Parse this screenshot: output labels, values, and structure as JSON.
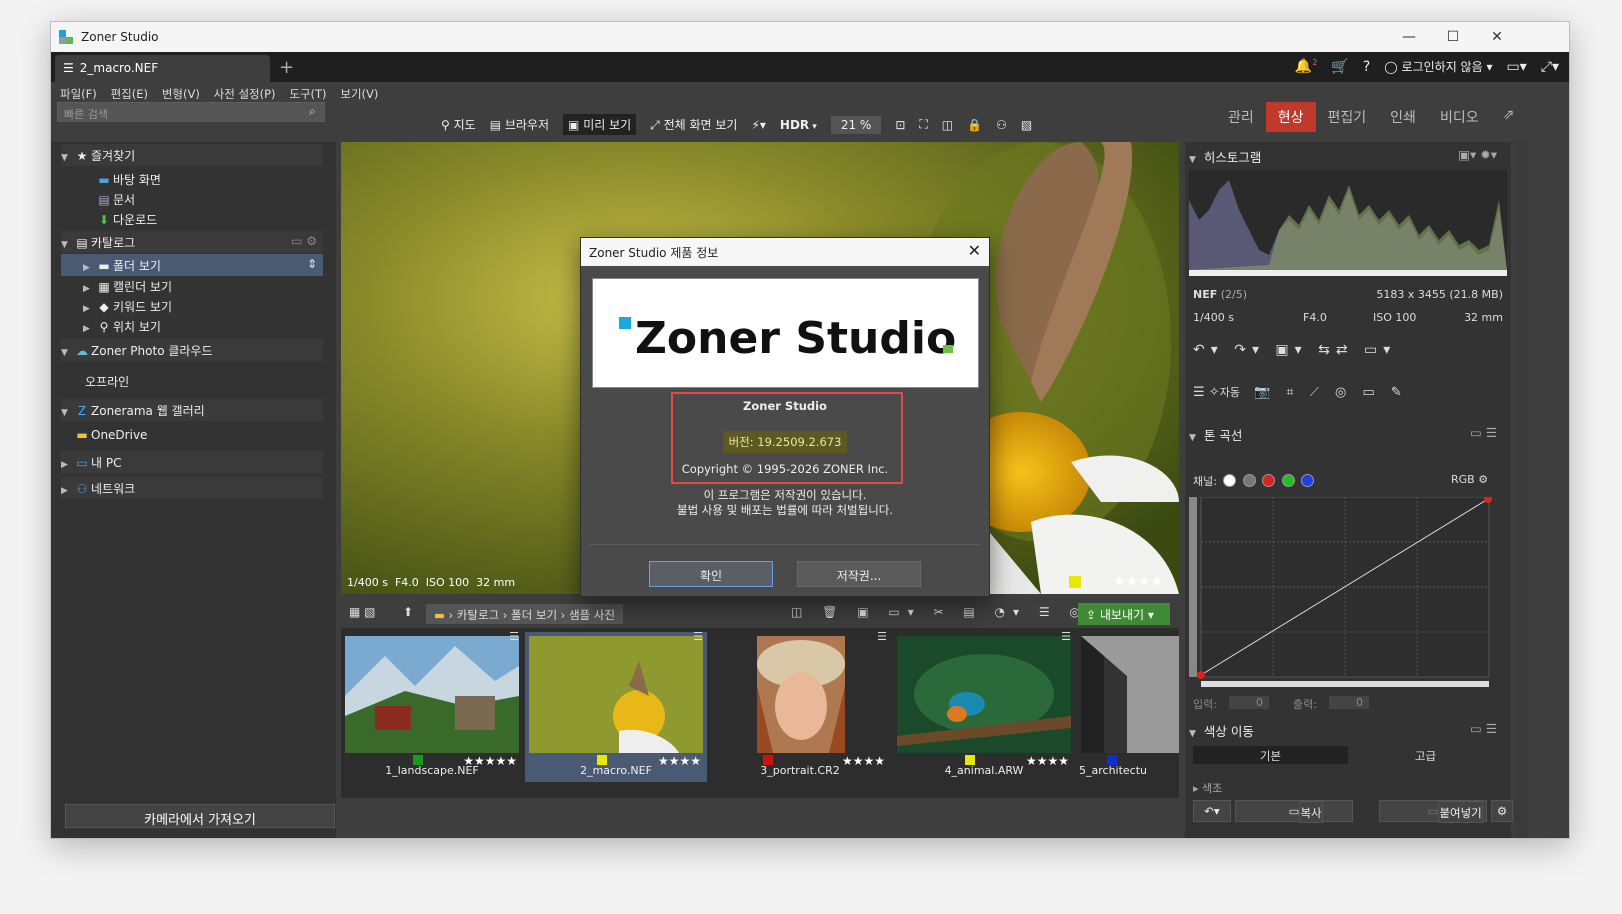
{
  "window": {
    "title": "Zoner Studio"
  },
  "tab": {
    "label": "2_macro.NEF",
    "notif_count": "2"
  },
  "account": {
    "label": "로그인하지 않음"
  },
  "menu": [
    "파일(F)",
    "편집(E)",
    "변형(V)",
    "사전 설정(P)",
    "도구(T)",
    "보기(V)"
  ],
  "search": {
    "placeholder": "빠른 검색"
  },
  "view_buttons": [
    "지도",
    "브라우저",
    "미리 보기",
    "전체 화면 보기"
  ],
  "hdr": "HDR",
  "zoom": "21 %",
  "modes": [
    "관리",
    "현상",
    "편집기",
    "인쇄",
    "비디오"
  ],
  "sidebar": {
    "favorites": "즐겨찾기",
    "fav_items": [
      "바탕 화면",
      "문서",
      "다운로드"
    ],
    "catalog": "카탈로그",
    "catalog_items": [
      "폴더 보기",
      "캘린더 보기",
      "키워드 보기",
      "위치 보기"
    ],
    "cloud": "Zoner Photo 클라우드",
    "offline": "오프라인",
    "zonerama": "Zonerama 웹 갤러리",
    "onedrive": "OneDrive",
    "mypc": "내 PC",
    "network": "네트워크",
    "import": "카메라에서 가져오기"
  },
  "photo": {
    "shutter": "1/400 s",
    "aperture": "F4.0",
    "iso": "ISO 100",
    "focal": "32 mm",
    "stars": "★★★★"
  },
  "breadcrumb": [
    "카탈로그",
    "폴더 보기",
    "샘플 사진"
  ],
  "export": "내보내기",
  "thumbnails": [
    {
      "name": "1_landscape.NEF",
      "stars": "★★★★★",
      "flag": "#1a9a1a"
    },
    {
      "name": "2_macro.NEF",
      "stars": "★★★★",
      "flag": "#e8e800"
    },
    {
      "name": "3_portrait.CR2",
      "stars": "★★★★",
      "flag": "#d01010"
    },
    {
      "name": "4_animal.ARW",
      "stars": "★★★★",
      "flag": "#e8e800"
    },
    {
      "name": "5_architectu",
      "stars": "",
      "flag": "#1030d0"
    }
  ],
  "right": {
    "histogram": "히스토그램",
    "format": "NEF",
    "index": "(2/5)",
    "dims": "5183 x 3455 (21.8 MB)",
    "shutter": "1/400 s",
    "aperture": "F4.0",
    "iso": "ISO 100",
    "focal": "32 mm",
    "auto": "자동",
    "tone_curve": "톤 곡선",
    "channel": "채널:",
    "rgb": "RGB",
    "input": "입력:",
    "input_val": "0",
    "output": "출력:",
    "output_val": "0",
    "color_shift": "색상 이동",
    "tab_basic": "기본",
    "tab_adv": "고급",
    "copy": "복사",
    "paste": "붙여넣기",
    "partial": "색조"
  },
  "dialog": {
    "title": "Zoner Studio 제품 정보",
    "logo_text": "Zoner Studio",
    "product": "Zoner Studio",
    "version": "버전: 19.2509.2.673",
    "copyright": "Copyright © 1995-2026 ZONER Inc.",
    "notice1": "이 프로그램은 저작권이 있습니다.",
    "notice2": "불법 사용 및 배포는 법률에 따라 처벌됩니다.",
    "ok": "확인",
    "license": "저작권..."
  }
}
